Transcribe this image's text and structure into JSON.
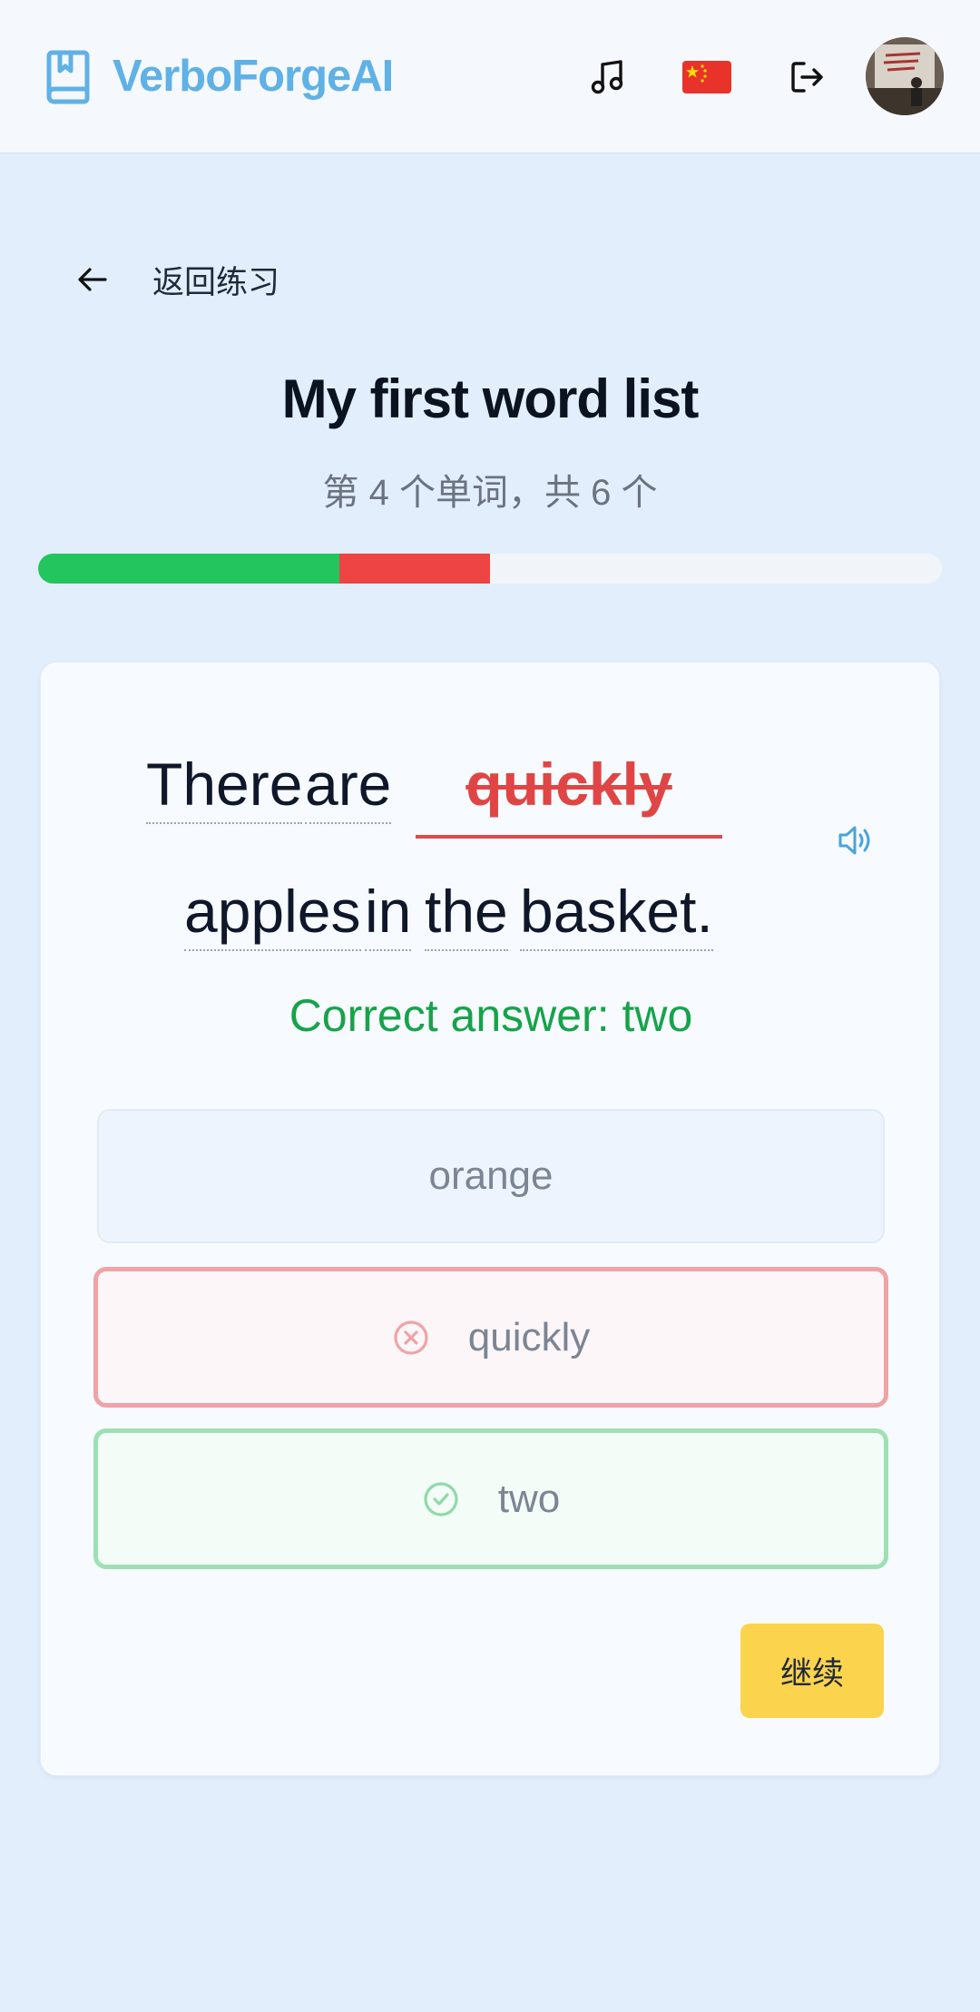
{
  "header": {
    "brand": "VerboForgeAI",
    "icons": [
      "book-icon",
      "music-icon",
      "china-flag-icon",
      "logout-icon",
      "avatar"
    ]
  },
  "nav": {
    "back_label": "返回练习"
  },
  "list": {
    "title": "My first word list",
    "counter": "第 4 个单词，共 6 个",
    "progress": {
      "correct_fraction": 0.333,
      "wrong_fraction": 0.167
    }
  },
  "sentence": {
    "words_before": [
      "There",
      "are"
    ],
    "selected_answer": "quickly",
    "words_after": [
      "apples",
      "in",
      "the",
      "basket."
    ],
    "correct_answer_text": "Correct answer: two"
  },
  "options": [
    {
      "label": "orange",
      "state": "neutral"
    },
    {
      "label": "quickly",
      "state": "wrong"
    },
    {
      "label": "two",
      "state": "correct"
    }
  ],
  "actions": {
    "continue_label": "继续"
  },
  "colors": {
    "brand": "#5fb1e6",
    "correct": "#22c55e",
    "wrong": "#ef4444",
    "continue": "#fcd34d"
  }
}
